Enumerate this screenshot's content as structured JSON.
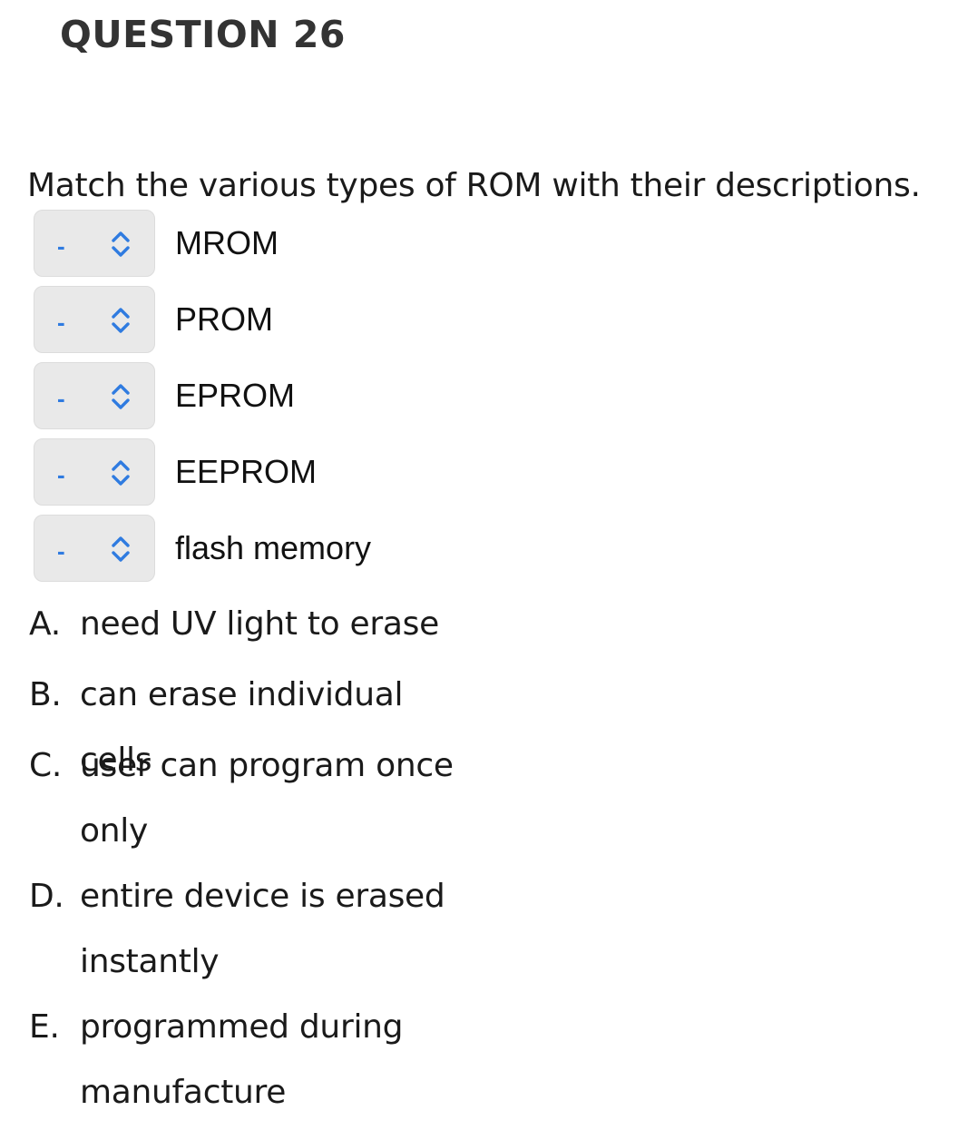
{
  "question": {
    "title": "QUESTION 26",
    "prompt": "Match the various types of ROM with their descriptions."
  },
  "match_items": [
    {
      "selected": "-",
      "label": "MROM"
    },
    {
      "selected": "-",
      "label": "PROM"
    },
    {
      "selected": "-",
      "label": "EPROM"
    },
    {
      "selected": "-",
      "label": "EEPROM"
    },
    {
      "selected": "-",
      "label": "flash memory"
    }
  ],
  "answers": [
    {
      "letter": "A.",
      "text": "need UV light to erase"
    },
    {
      "letter": "B.",
      "text": "can erase individual cells"
    },
    {
      "letter": "C.",
      "text": "user can program once only"
    },
    {
      "letter": "D.",
      "text": "entire device is erased instantly"
    },
    {
      "letter": "E.",
      "text": "programmed during manufacture"
    }
  ],
  "colors": {
    "accent": "#2f7be0",
    "select_bg": "#e9e9e9",
    "title": "#333333"
  },
  "icons": {
    "select_indicator": "chevron-up-down-icon"
  }
}
